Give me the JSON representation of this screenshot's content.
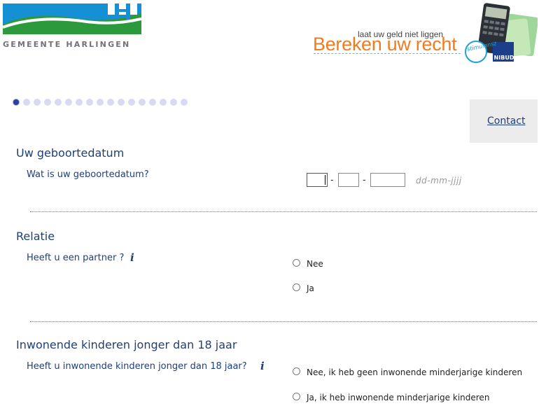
{
  "header": {
    "logo_text": "GEMEENTE HARLINGEN",
    "banner_tagline": "laat uw geld niet liggen",
    "banner_title": "Bereken uw recht",
    "badge_stimulansz": "stimulansz",
    "badge_nibud": "NIBUD"
  },
  "steps": {
    "total": 17,
    "current": 1
  },
  "contact_label": "Contact",
  "birthdate": {
    "section_title": "Uw geboortedatum",
    "question": "Wat is uw geboortedatum?",
    "separator": "-",
    "format_hint": "dd-mm-jjjj",
    "day": "",
    "month": "",
    "year": ""
  },
  "relation": {
    "section_title": "Relatie",
    "question": "Heeft u een partner ?",
    "options": [
      "Nee",
      "Ja"
    ]
  },
  "children": {
    "section_title": "Inwonende kinderen jonger dan 18 jaar",
    "question": "Heeft u inwonende kinderen jonger dan 18 jaar?",
    "options": [
      "Nee, ik heb geen inwonende minderjarige kinderen",
      "Ja, ik heb inwonende minderjarige kinderen"
    ]
  },
  "colors": {
    "heading": "#1f3f78",
    "banner_orange": "#ef7c21",
    "step_dot": "#d9d9f3",
    "step_active": "#2a3ea8"
  },
  "icons": {
    "info": "info-icon"
  }
}
